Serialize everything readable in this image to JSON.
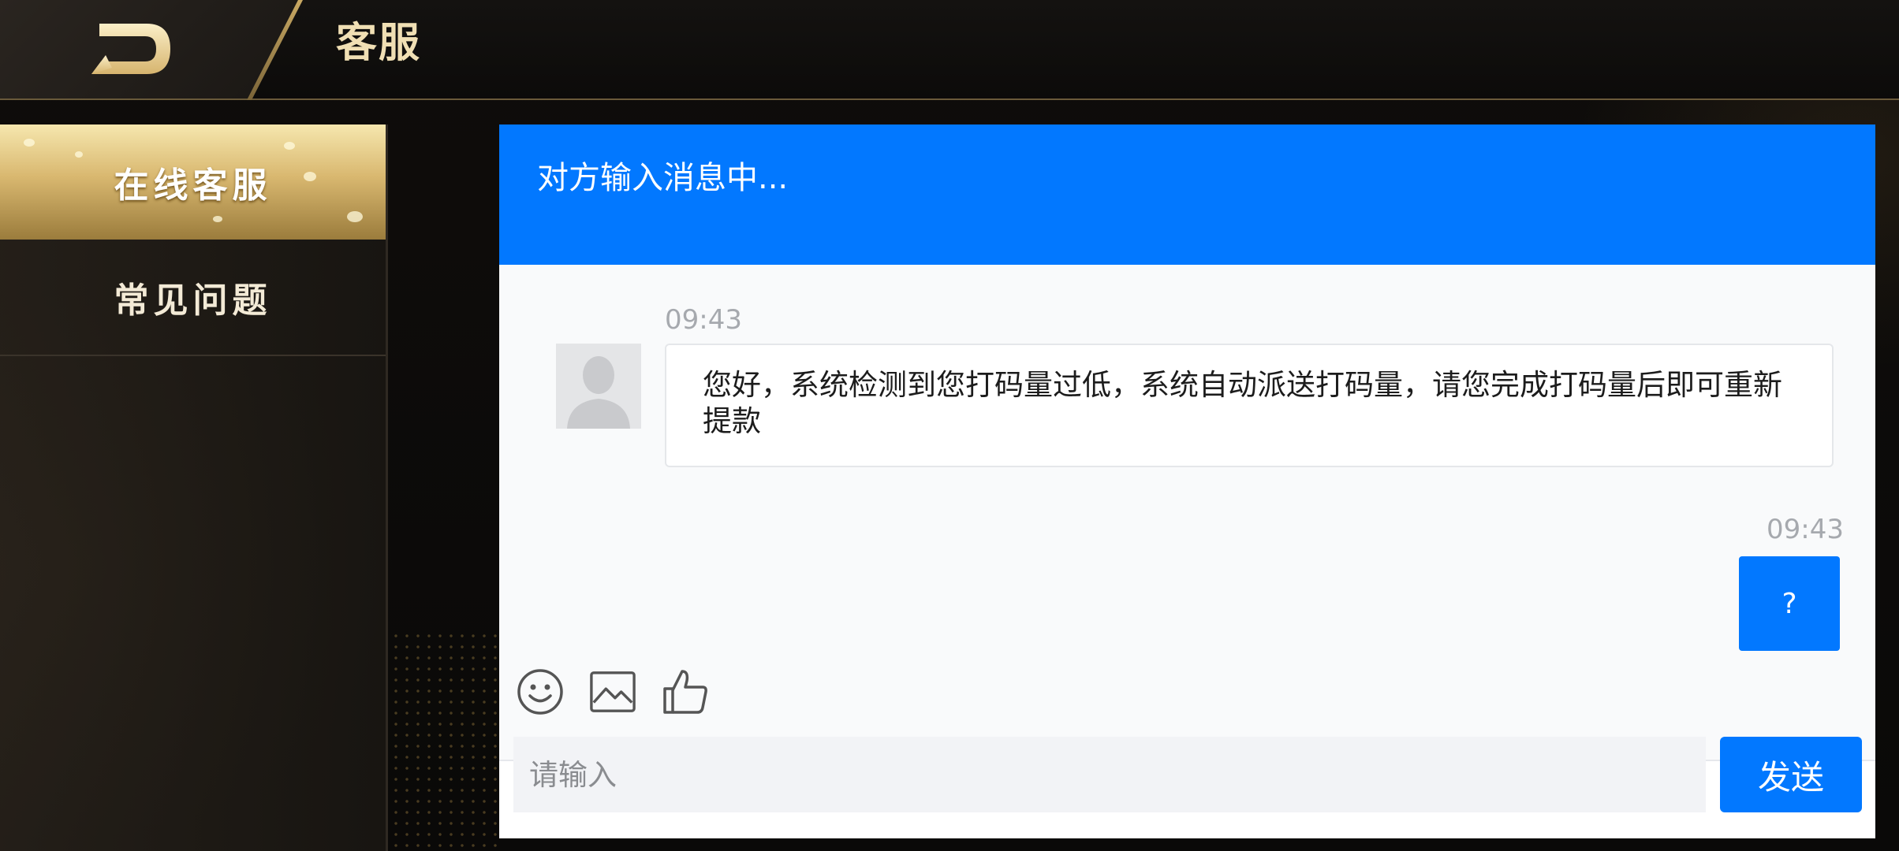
{
  "header": {
    "title": "客服",
    "back_icon": "back-arrow-icon"
  },
  "sidebar": {
    "items": [
      {
        "label": "在线客服",
        "active": true
      },
      {
        "label": "常见问题",
        "active": false
      }
    ]
  },
  "chat": {
    "status_text": "对方输入消息中...",
    "messages": [
      {
        "side": "left",
        "time": "09:43",
        "text": "您好，系统检测到您打码量过低，系统自动派送打码量，请您完成打码量后即可重新提款"
      },
      {
        "side": "right",
        "time": "09:43",
        "text": "?"
      }
    ],
    "toolbar": [
      "emoji-icon",
      "image-icon",
      "thumbs-up-icon"
    ],
    "input_placeholder": "请输入",
    "input_value": "",
    "send_label": "发送"
  },
  "colors": {
    "accent_blue": "#0278ff",
    "gold": "#d9b870",
    "background": "#0c0b0a"
  }
}
